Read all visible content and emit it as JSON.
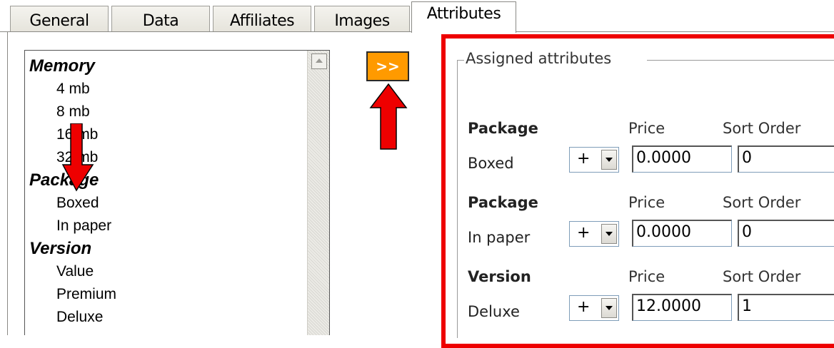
{
  "tabs": [
    {
      "label": "General"
    },
    {
      "label": "Data"
    },
    {
      "label": "Affiliates"
    },
    {
      "label": "Images"
    },
    {
      "label": "Attributes",
      "active": true
    }
  ],
  "attribute_list": {
    "groups": [
      {
        "name": "Memory",
        "options": [
          "4 mb",
          "8 mb",
          "16 mb",
          "32 mb"
        ]
      },
      {
        "name": "Package",
        "options": [
          "Boxed",
          "In paper"
        ]
      },
      {
        "name": "Version",
        "options": [
          "Value",
          "Premium",
          "Deluxe"
        ]
      }
    ]
  },
  "add_button": {
    "label": ">>",
    "color": "#ff9a00"
  },
  "assigned": {
    "legend": "Assigned attributes",
    "price_header": "Price",
    "sort_header": "Sort Order",
    "rows": [
      {
        "group": "Package",
        "option": "Boxed",
        "prefix": "+",
        "price": "0.0000",
        "sort": "0"
      },
      {
        "group": "Package",
        "option": "In paper",
        "prefix": "+",
        "price": "0.0000",
        "sort": "0"
      },
      {
        "group": "Version",
        "option": "Deluxe",
        "prefix": "+",
        "price": "12.0000",
        "sort": "1"
      }
    ]
  },
  "annotations": {
    "highlight_color": "#ee0000",
    "arrow_color": "#ee0000"
  }
}
